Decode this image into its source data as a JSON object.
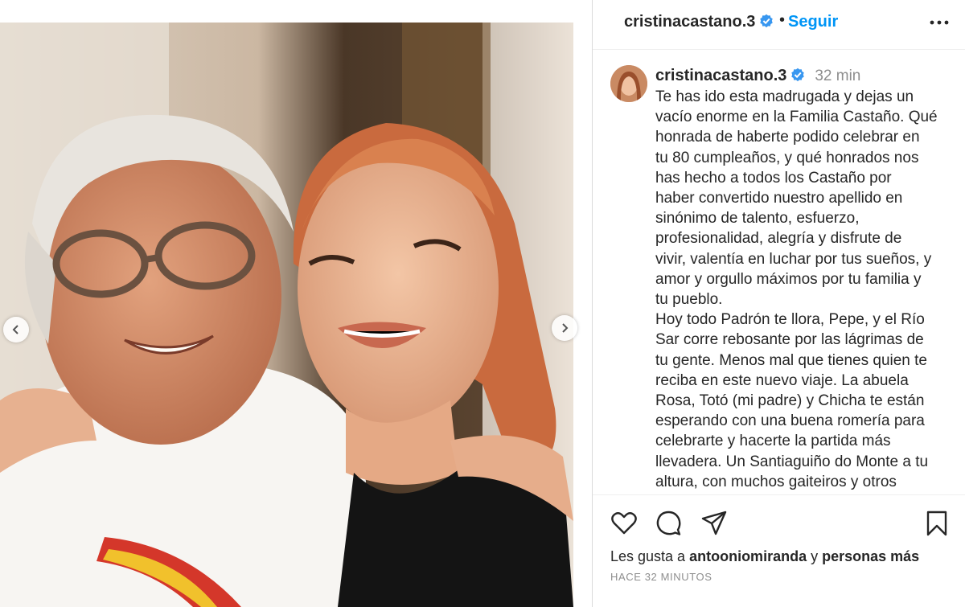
{
  "photo": {
    "alt": "",
    "prev_icon": "chevron-left-icon",
    "next_icon": "chevron-right-icon"
  },
  "header": {
    "username": "cristinacastano.3",
    "dot": "•",
    "follow_label": "Seguir",
    "more_icon": "more-horizontal-icon"
  },
  "caption": {
    "username": "cristinacastano.3",
    "time": "32 min",
    "text": "Te has ido esta madrugada y dejas un\nvacío enorme en la Familia Castaño. Qué\nhonrada de haberte podido celebrar en\ntu 80 cumpleaños, y qué honrados nos\nhas hecho a todos los Castaño por\nhaber convertido nuestro apellido en\nsinónimo de talento, esfuerzo,\nprofesionalidad, alegría y disfrute de\nvivir, valentía en luchar por tus sueños, y\namor y orgullo máximos por tu familia y\ntu pueblo.\nHoy todo Padrón te llora, Pepe, y el Río\nSar corre rebosante por las lágrimas de\ntu gente. Menos mal que tienes quien te\nreciba en este nuevo viaje. La abuela\nRosa, Totó (mi padre) y Chicha te están\nesperando con una buena romería para\ncelebrarte y hacerte la partida más\nllevadera. Un Santiaguiño do Monte a tu\naltura, con muchos gaiteiros y otros"
  },
  "actions": {
    "like_icon": "heart-icon",
    "comment_icon": "comment-icon",
    "share_icon": "paper-plane-icon",
    "save_icon": "bookmark-icon",
    "likes_prefix": "Les gusta a ",
    "likes_user": "antooniomiranda",
    "likes_mid": " y ",
    "likes_suffix": "personas más",
    "timestamp": "HACE 32 MINUTOS"
  },
  "colors": {
    "accent": "#0095f6",
    "verified": "#3897f0",
    "text": "#262626",
    "muted": "#8e8e8e"
  }
}
